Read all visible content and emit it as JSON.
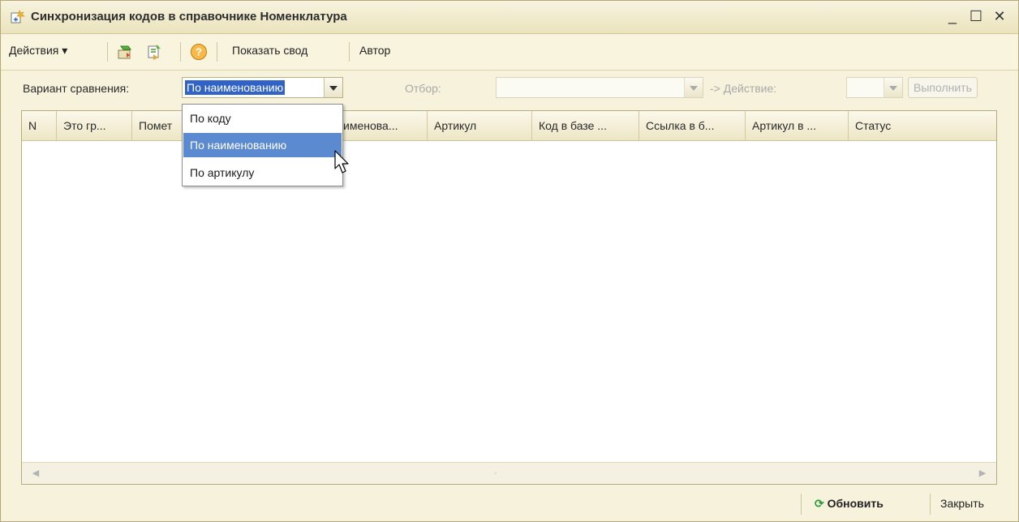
{
  "window": {
    "title": "Синхронизация кодов в справочнике Номенклатура",
    "minimize_glyph": "_",
    "maximize_glyph": "☐",
    "close_glyph": "✕"
  },
  "toolbar": {
    "actions_label": "Действия",
    "actions_arrow": "▾",
    "show_summary_label": "Показать свод",
    "author_label": "Автор",
    "icons": [
      "export-green-icon",
      "import-green-icon",
      "help-icon"
    ]
  },
  "filters": {
    "compare_label": "Вариант сравнения:",
    "compare_value": "По наименованию",
    "filter_label": "Отбор:",
    "action_label": "-> Действие:",
    "execute_label": "Выполнить"
  },
  "grid": {
    "columns": [
      "N",
      "Это гр...",
      "Помет",
      "именова...",
      "Артикул",
      "Код в базе ...",
      "Ссылка в б...",
      "Артикул в ...",
      "Статус"
    ],
    "rows": [],
    "scroll_left": "◀",
    "scroll_right": "▶",
    "scroll_grip": "▫"
  },
  "dropdown": {
    "options": [
      "По коду",
      "По наименованию",
      "По артикулу"
    ],
    "selected_index": 1
  },
  "bottom": {
    "refresh_icon": "⟳",
    "refresh_label": "Обновить",
    "close_label": "Закрыть"
  },
  "colors": {
    "window_bg": "#f6f2dc",
    "selection": "#3163c7",
    "dropdown_highlight": "#5b8ad0",
    "refresh_green": "#2e9a3a"
  }
}
